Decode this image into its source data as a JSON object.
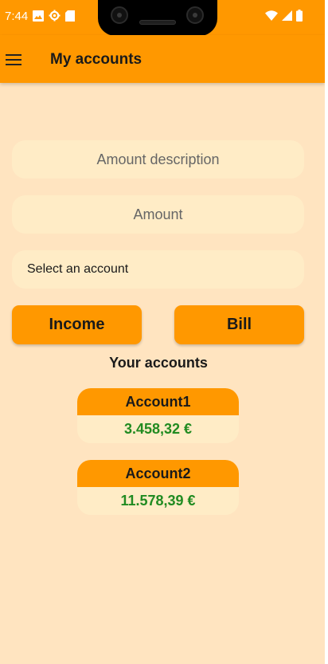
{
  "status_bar": {
    "time": "7:44"
  },
  "app_bar": {
    "title": "My accounts"
  },
  "form": {
    "description_placeholder": "Amount description",
    "amount_placeholder": "Amount",
    "account_select_label": "Select an account",
    "income_label": "Income",
    "bill_label": "Bill"
  },
  "accounts_section": {
    "heading": "Your accounts",
    "accounts": [
      {
        "name": "Account1",
        "balance": "3.458,32 €"
      },
      {
        "name": "Account2",
        "balance": "11.578,39 €"
      }
    ]
  },
  "colors": {
    "primary": "#ff9800",
    "background": "#ffe4c0",
    "field_background": "#ffecc6",
    "balance_text": "#218b21"
  },
  "icons": {
    "status_left": [
      "photo-icon",
      "settings-icon",
      "sd-card-icon"
    ],
    "status_right": [
      "wifi-icon",
      "signal-icon",
      "battery-icon"
    ],
    "app_bar": "menu-icon"
  }
}
